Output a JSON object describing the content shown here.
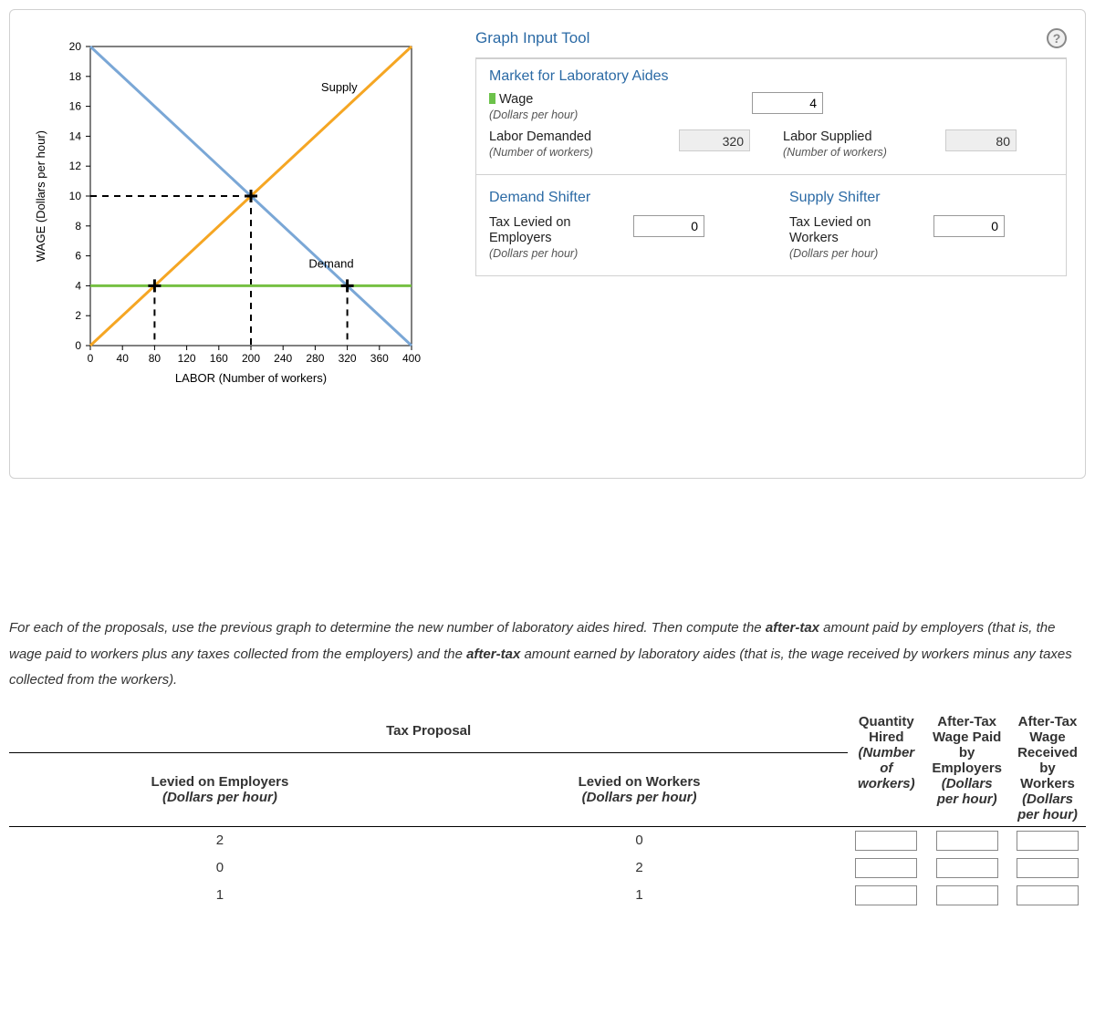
{
  "panel": {
    "tool_title": "Graph Input Tool",
    "market_title": "Market for Laboratory Aides",
    "wage_label": "Wage",
    "wage_sub": "(Dollars per hour)",
    "wage_value": "4",
    "labor_demanded_label": "Labor Demanded",
    "labor_demanded_sub": "(Number of workers)",
    "labor_demanded_value": "320",
    "labor_supplied_label": "Labor Supplied",
    "labor_supplied_sub": "(Number of workers)",
    "labor_supplied_value": "80",
    "demand_shifter_title": "Demand Shifter",
    "supply_shifter_title": "Supply Shifter",
    "tax_employers_label": "Tax Levied on Employers",
    "tax_employers_sub": "(Dollars per hour)",
    "tax_employers_value": "0",
    "tax_workers_label": "Tax Levied on Workers",
    "tax_workers_sub": "(Dollars per hour)",
    "tax_workers_value": "0"
  },
  "chart_data": {
    "type": "line",
    "title": "",
    "xlabel": "LABOR (Number of workers)",
    "ylabel": "WAGE (Dollars per hour)",
    "xlim": [
      0,
      400
    ],
    "ylim": [
      0,
      20
    ],
    "xticks": [
      0,
      40,
      80,
      120,
      160,
      200,
      240,
      280,
      320,
      360,
      400
    ],
    "yticks": [
      0,
      2,
      4,
      6,
      8,
      10,
      12,
      14,
      16,
      18,
      20
    ],
    "series": [
      {
        "name": "Supply",
        "color": "#f5a623",
        "points": [
          [
            0,
            0
          ],
          [
            400,
            20
          ]
        ]
      },
      {
        "name": "Demand",
        "color": "#7aa7d6",
        "points": [
          [
            0,
            20
          ],
          [
            400,
            0
          ]
        ]
      },
      {
        "name": "WageLine",
        "color": "#76c043",
        "points": [
          [
            0,
            4
          ],
          [
            400,
            4
          ]
        ]
      }
    ],
    "markers": [
      {
        "x": 80,
        "y": 4
      },
      {
        "x": 320,
        "y": 4
      },
      {
        "x": 200,
        "y": 10
      }
    ],
    "guides": [
      {
        "from": [
          0,
          10
        ],
        "to": [
          200,
          10
        ]
      },
      {
        "from": [
          200,
          10
        ],
        "to": [
          200,
          0
        ]
      },
      {
        "from": [
          80,
          4
        ],
        "to": [
          80,
          0
        ]
      },
      {
        "from": [
          320,
          4
        ],
        "to": [
          320,
          0
        ]
      }
    ],
    "annotations": [
      {
        "text": "Supply",
        "x": 310,
        "y": 17
      },
      {
        "text": "Demand",
        "x": 300,
        "y": 5.2
      }
    ]
  },
  "instructions": {
    "text_p1": "For each of the proposals, use the previous graph to determine the new number of laboratory aides hired. Then compute the ",
    "bold1": "after-tax",
    "text_p2": " amount paid by employers (that is, the wage paid to workers plus any taxes collected from the employers) and the ",
    "bold2": "after-tax",
    "text_p3": " amount earned by laboratory aides (that is, the wage received by workers minus any taxes collected from the workers)."
  },
  "table": {
    "h_tax_proposal": "Tax Proposal",
    "h_qty": "Quantity Hired",
    "h_qty_sub": "(Number of workers)",
    "h_paid": "After-Tax Wage Paid by Employers",
    "h_paid_sub": "(Dollars per hour)",
    "h_recv": "After-Tax Wage Received by Workers",
    "h_recv_sub": "(Dollars per hour)",
    "h_lev_emp": "Levied on Employers",
    "h_lev_emp_sub": "(Dollars per hour)",
    "h_lev_wrk": "Levied on Workers",
    "h_lev_wrk_sub": "(Dollars per hour)",
    "rows": [
      {
        "emp": "2",
        "wrk": "0"
      },
      {
        "emp": "0",
        "wrk": "2"
      },
      {
        "emp": "1",
        "wrk": "1"
      }
    ]
  }
}
